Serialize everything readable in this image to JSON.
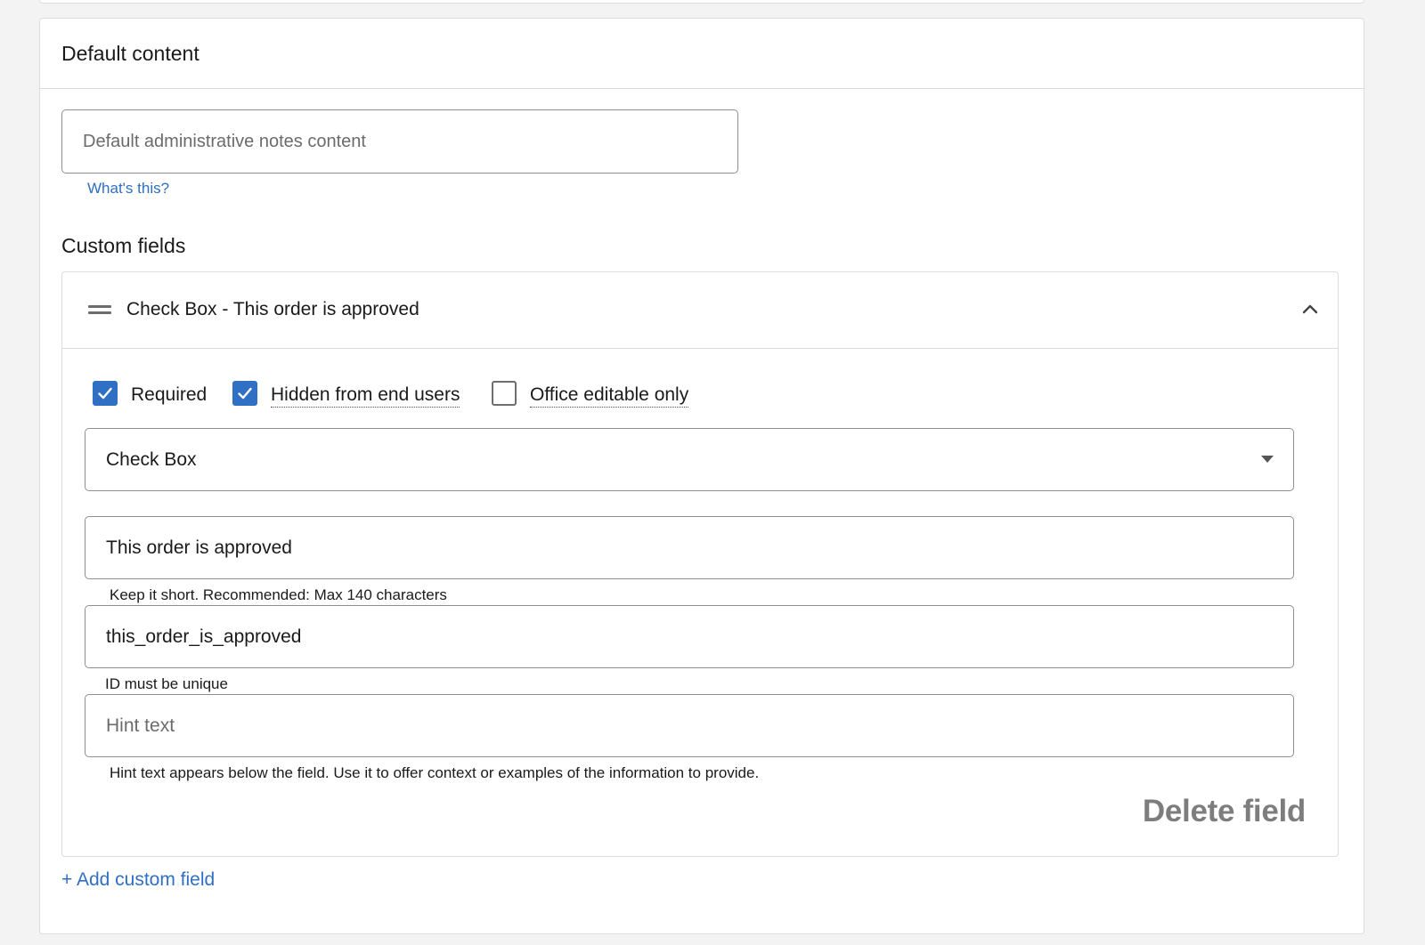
{
  "default_content": {
    "title": "Default content",
    "notes_placeholder": "Default administrative notes content",
    "notes_value": "",
    "help_link": "What's this?"
  },
  "custom_fields": {
    "title": "Custom fields",
    "field": {
      "header_title": "Check Box - This order is approved",
      "options": {
        "required": {
          "label": "Required",
          "checked": true
        },
        "hidden": {
          "label": "Hidden from end users",
          "checked": true
        },
        "office_editable": {
          "label": "Office editable only",
          "checked": false
        }
      },
      "type_select": {
        "value": "Check Box"
      },
      "label_input": {
        "value": "This order is approved",
        "help": "Keep it short. Recommended: Max 140 characters"
      },
      "id_input": {
        "value": "this_order_is_approved",
        "help": "ID must be unique"
      },
      "hint_input": {
        "value": "",
        "placeholder": "Hint text",
        "help": "Hint text appears below the field. Use it to offer context or examples of the information to provide."
      },
      "delete_label": "Delete field"
    },
    "add_label": "+ Add custom field"
  },
  "colors": {
    "accent": "#2f6fc4",
    "border": "#dcdcdc",
    "background": "#f3f3f3",
    "muted_button": "#7d7d7d"
  },
  "icons": {
    "drag": "drag-handle-icon",
    "collapse": "chevron-up-icon",
    "checkbox_checked": "checkmark-icon",
    "dropdown": "caret-down-icon"
  }
}
